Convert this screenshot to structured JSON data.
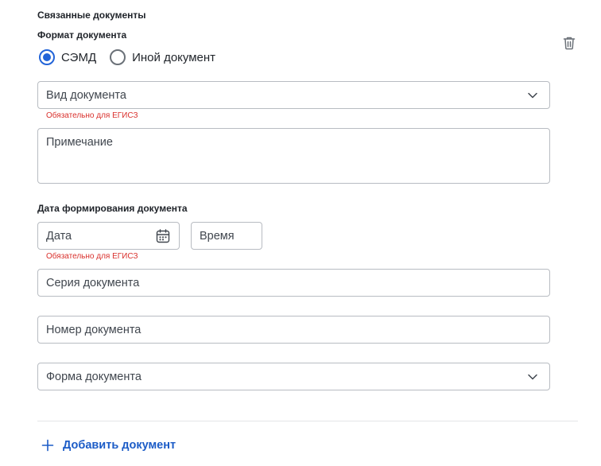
{
  "section": {
    "title": "Связанные документы"
  },
  "format": {
    "label": "Формат документа",
    "options": [
      {
        "label": "СЭМД",
        "selected": true
      },
      {
        "label": "Иной документ",
        "selected": false
      }
    ]
  },
  "doc_type": {
    "placeholder": "Вид документа",
    "error": "Обязательно для ЕГИСЗ"
  },
  "note": {
    "placeholder": "Примечание"
  },
  "creation_date": {
    "label": "Дата формирования документа",
    "date_placeholder": "Дата",
    "time_placeholder": "Время",
    "error": "Обязательно для ЕГИСЗ"
  },
  "series": {
    "placeholder": "Серия документа"
  },
  "number": {
    "placeholder": "Номер документа"
  },
  "form": {
    "placeholder": "Форма документа"
  },
  "add_button": {
    "label": "Добавить документ"
  },
  "icons": {
    "delete": "trash-icon",
    "dropdown": "chevron-down-icon",
    "calendar": "calendar-icon",
    "add": "plus-icon"
  },
  "colors": {
    "accent": "#2264d8",
    "error": "#d9302c",
    "link": "#1c5cc7",
    "border": "#b8bcc2"
  }
}
